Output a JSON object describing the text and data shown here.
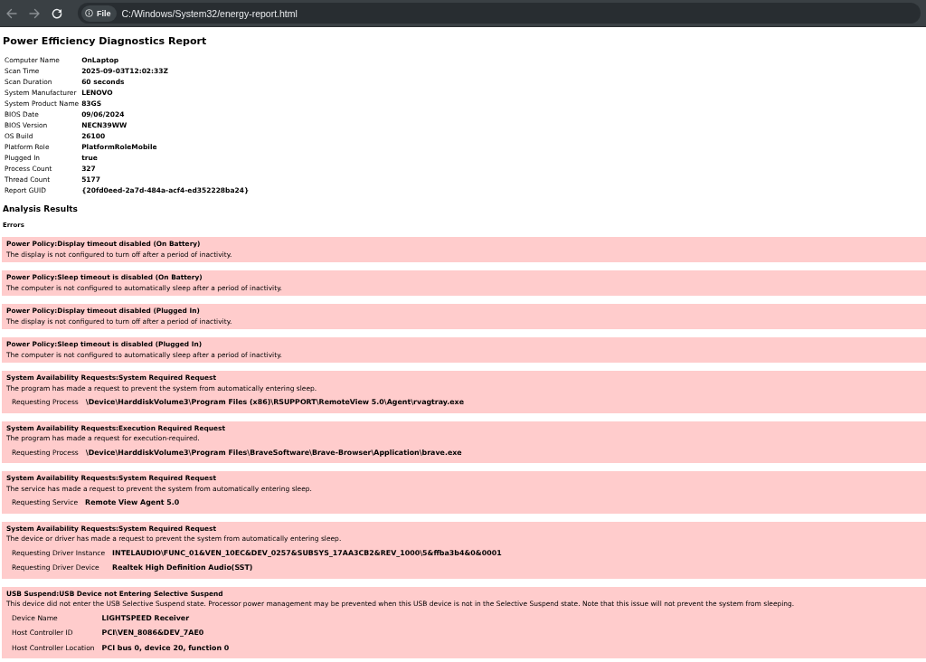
{
  "browser": {
    "back_disabled": true,
    "forward_disabled": true,
    "scheme_chip": "File",
    "url": "C:/Windows/System32/energy-report.html"
  },
  "report": {
    "title": "Power Efficiency Diagnostics Report",
    "system_info": [
      {
        "label": "Computer Name",
        "value": "OnLaptop"
      },
      {
        "label": "Scan Time",
        "value": "2025-09-03T12:02:33Z"
      },
      {
        "label": "Scan Duration",
        "value": "60 seconds"
      },
      {
        "label": "System Manufacturer",
        "value": "LENOVO"
      },
      {
        "label": "System Product Name",
        "value": "83GS"
      },
      {
        "label": "BIOS Date",
        "value": "09/06/2024"
      },
      {
        "label": "BIOS Version",
        "value": "NECN39WW"
      },
      {
        "label": "OS Build",
        "value": "26100"
      },
      {
        "label": "Platform Role",
        "value": "PlatformRoleMobile"
      },
      {
        "label": "Plugged In",
        "value": "true"
      },
      {
        "label": "Process Count",
        "value": "327"
      },
      {
        "label": "Thread Count",
        "value": "5177"
      },
      {
        "label": "Report GUID",
        "value": "{20fd0eed-2a7d-484a-acf4-ed352228ba24}"
      }
    ],
    "analysis_heading": "Analysis Results",
    "errors_heading": "Errors",
    "errors": [
      {
        "title": "Power Policy:Display timeout disabled (On Battery)",
        "description": "The display is not configured to turn off after a period of inactivity."
      },
      {
        "title": "Power Policy:Sleep timeout is disabled (On Battery)",
        "description": "The computer is not configured to automatically sleep after a period of inactivity."
      },
      {
        "title": "Power Policy:Display timeout disabled (Plugged In)",
        "description": "The display is not configured to turn off after a period of inactivity."
      },
      {
        "title": "Power Policy:Sleep timeout is disabled (Plugged In)",
        "description": "The computer is not configured to automatically sleep after a period of inactivity."
      },
      {
        "title": "System Availability Requests:System Required Request",
        "description": "The program has made a request to prevent the system from automatically entering sleep.",
        "details": [
          {
            "label": "Requesting Process",
            "value": "\\Device\\HarddiskVolume3\\Program Files (x86)\\RSUPPORT\\RemoteView 5.0\\Agent\\rvagtray.exe"
          }
        ]
      },
      {
        "title": "System Availability Requests:Execution Required Request",
        "description": "The program has made a request for execution-required.",
        "details": [
          {
            "label": "Requesting Process",
            "value": "\\Device\\HarddiskVolume3\\Program Files\\BraveSoftware\\Brave-Browser\\Application\\brave.exe"
          }
        ]
      },
      {
        "title": "System Availability Requests:System Required Request",
        "description": "The service has made a request to prevent the system from automatically entering sleep.",
        "details": [
          {
            "label": "Requesting Service",
            "value": "Remote View Agent 5.0"
          }
        ]
      },
      {
        "title": "System Availability Requests:System Required Request",
        "description": "The device or driver has made a request to prevent the system from automatically entering sleep.",
        "details": [
          {
            "label": "Requesting Driver Instance",
            "value": "INTELAUDIO\\FUNC_01&VEN_10EC&DEV_0257&SUBSYS_17AA3CB2&REV_1000\\5&ffba3b4&0&0001"
          },
          {
            "label": "Requesting Driver Device",
            "value": "Realtek High Definition Audio(SST)"
          }
        ]
      },
      {
        "title": "USB Suspend:USB Device not Entering Selective Suspend",
        "description": "This device did not enter the USB Selective Suspend state. Processor power management may be prevented when this USB device is not in the Selective Suspend state. Note that this issue will not prevent the system from sleeping.",
        "details": [
          {
            "label": "Device Name",
            "value": "LIGHTSPEED Receiver"
          },
          {
            "label": "Host Controller ID",
            "value": "PCI\\VEN_8086&DEV_7AE0"
          },
          {
            "label": "Host Controller Location",
            "value": "PCI bus 0, device 20, function 0"
          }
        ]
      }
    ]
  }
}
